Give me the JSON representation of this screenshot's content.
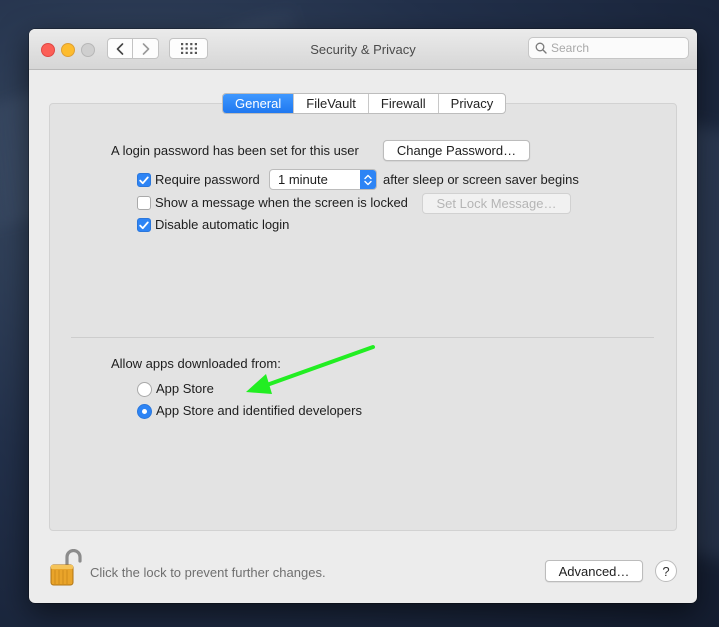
{
  "window": {
    "title": "Security & Privacy",
    "search_placeholder": "Search"
  },
  "tabs": [
    {
      "label": "General",
      "active": true
    },
    {
      "label": "FileVault",
      "active": false
    },
    {
      "label": "Firewall",
      "active": false
    },
    {
      "label": "Privacy",
      "active": false
    }
  ],
  "general": {
    "login_password_text": "A login password has been set for this user",
    "change_password_label": "Change Password…",
    "require_password": {
      "checked": true,
      "label": "Require password"
    },
    "require_password_delay": "1 minute",
    "require_password_suffix": "after sleep or screen saver begins",
    "show_message": {
      "checked": false,
      "label": "Show a message when the screen is locked"
    },
    "set_lock_message_label": "Set Lock Message…",
    "disable_auto_login": {
      "checked": true,
      "label": "Disable automatic login"
    }
  },
  "allow_apps": {
    "heading": "Allow apps downloaded from:",
    "options": [
      {
        "label": "App Store",
        "selected": false
      },
      {
        "label": "App Store and identified developers",
        "selected": true
      }
    ]
  },
  "footer": {
    "lock_text": "Click the lock to prevent further changes.",
    "advanced_label": "Advanced…",
    "help_label": "?"
  },
  "colors": {
    "accent": "#2d84f5",
    "annotation_arrow": "#22ee22"
  }
}
